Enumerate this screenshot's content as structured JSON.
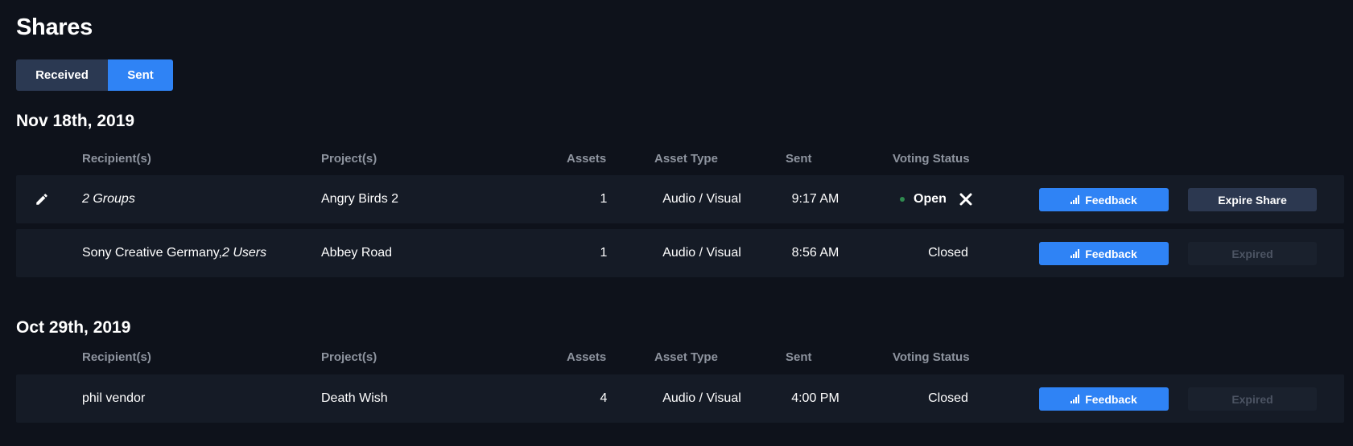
{
  "page": {
    "title": "Shares"
  },
  "tabs": {
    "received": "Received",
    "sent": "Sent",
    "active": "sent"
  },
  "columns": {
    "recipients": "Recipient(s)",
    "projects": "Project(s)",
    "assets": "Assets",
    "asset_type": "Asset Type",
    "sent": "Sent",
    "voting_status": "Voting Status"
  },
  "groups": [
    {
      "date": "Nov 18th, 2019",
      "rows": [
        {
          "recipient_main": "",
          "recipient_italic": "2 Groups",
          "project": "Angry Birds 2",
          "assets": "1",
          "asset_type": "Audio / Visual",
          "sent": "9:17 AM",
          "status": "Open",
          "feedback_label": "Feedback",
          "expire_label": "Expire Share"
        },
        {
          "recipient_main": "Sony Creative Germany, ",
          "recipient_italic": "2 Users",
          "project": "Abbey Road",
          "assets": "1",
          "asset_type": "Audio / Visual",
          "sent": "8:56 AM",
          "status": "Closed",
          "feedback_label": "Feedback",
          "expire_label": "Expired"
        }
      ]
    },
    {
      "date": "Oct 29th, 2019",
      "rows": [
        {
          "recipient_main": "phil vendor",
          "recipient_italic": "",
          "project": "Death Wish",
          "assets": "4",
          "asset_type": "Audio / Visual",
          "sent": "4:00 PM",
          "status": "Closed",
          "feedback_label": "Feedback",
          "expire_label": "Expired"
        }
      ]
    }
  ],
  "colors": {
    "background": "#0e121b",
    "row": "#151b26",
    "accent": "#2f83f5",
    "open_dot": "#2f8a4f",
    "muted_text": "#8e949f"
  },
  "icons": {
    "edit": "pencil-icon",
    "close": "close-icon",
    "feedback": "bar-chart-icon"
  }
}
